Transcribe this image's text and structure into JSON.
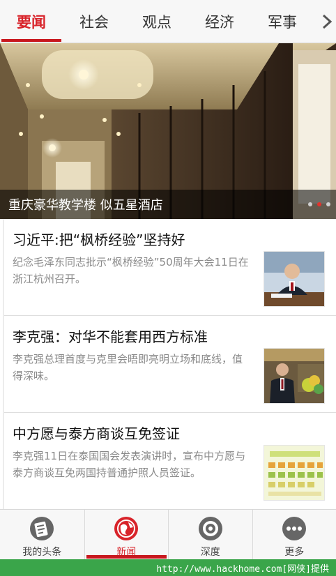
{
  "tabs": [
    {
      "label": "要闻",
      "active": true
    },
    {
      "label": "社会",
      "active": false
    },
    {
      "label": "观点",
      "active": false
    },
    {
      "label": "经济",
      "active": false
    },
    {
      "label": "军事",
      "active": false
    }
  ],
  "tabs_more_icon": "chevron-right-icon",
  "hero": {
    "caption": "重庆豪华教学楼 似五星酒店",
    "slide_count": 3,
    "active_slide": 2
  },
  "news": [
    {
      "title": "习近平:把“枫桥经验”坚持好",
      "summary": "纪念毛泽东同志批示“枫桥经验”50周年大会11日在浙江杭州召开。"
    },
    {
      "title": "李克强：对华不能套用西方标准",
      "summary": "李克强总理首度与克里会晤即亮明立场和底线，值得深味。"
    },
    {
      "title": "中方愿与泰方商谈互免签证",
      "summary": "李克强11日在泰国国会发表演讲时，宣布中方愿与泰方商谈互免两国持普通护照人员签证。"
    }
  ],
  "bottom_nav": [
    {
      "label": "我的头条",
      "icon": "my-headlines-icon",
      "active": false
    },
    {
      "label": "新闻",
      "icon": "globe-icon",
      "active": true
    },
    {
      "label": "深度",
      "icon": "target-icon",
      "active": false
    },
    {
      "label": "更多",
      "icon": "more-dots-icon",
      "active": false
    }
  ],
  "watermark": "http://www.hackhome.com[网侠]提供",
  "colors": {
    "accent": "#d8232a",
    "watermark_bg": "#3aa54a"
  }
}
